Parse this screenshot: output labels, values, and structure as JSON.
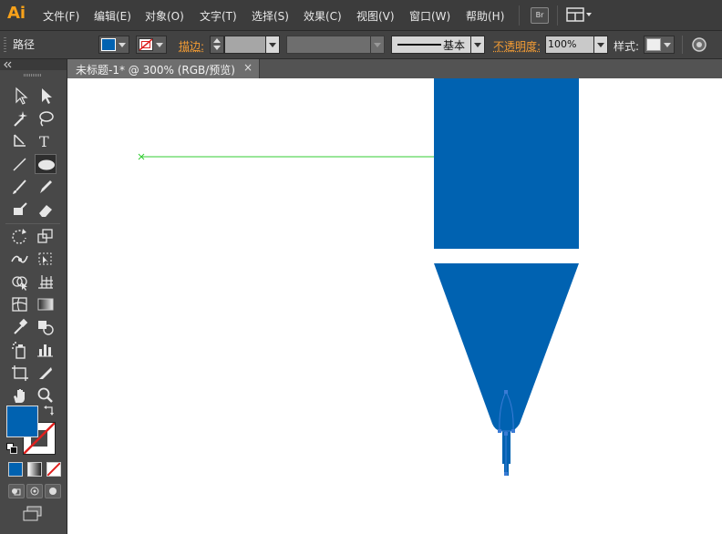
{
  "app": {
    "logo": "Ai"
  },
  "menu": [
    {
      "label": "文件(F)"
    },
    {
      "label": "编辑(E)"
    },
    {
      "label": "对象(O)"
    },
    {
      "label": "文字(T)"
    },
    {
      "label": "选择(S)"
    },
    {
      "label": "效果(C)"
    },
    {
      "label": "视图(V)"
    },
    {
      "label": "窗口(W)"
    },
    {
      "label": "帮助(H)"
    }
  ],
  "menu_right": {
    "bridge_label": "Br"
  },
  "control": {
    "selection_type": "路径",
    "fill_color": "#0062b1",
    "stroke_label": "描边:",
    "stroke_profile": "基本",
    "opacity_label": "不透明度:",
    "opacity_value": "100%",
    "style_label": "样式:"
  },
  "document": {
    "tab_title": "未标题-1* @ 300% (RGB/预览)",
    "close_glyph": "×"
  },
  "tools": {
    "fill_color": "#0062b1",
    "stroke_color": "none"
  },
  "artwork": {
    "shape_color": "#0062b1",
    "guide_color": "#33cc33",
    "anchor_color": "#3a7bd5"
  }
}
